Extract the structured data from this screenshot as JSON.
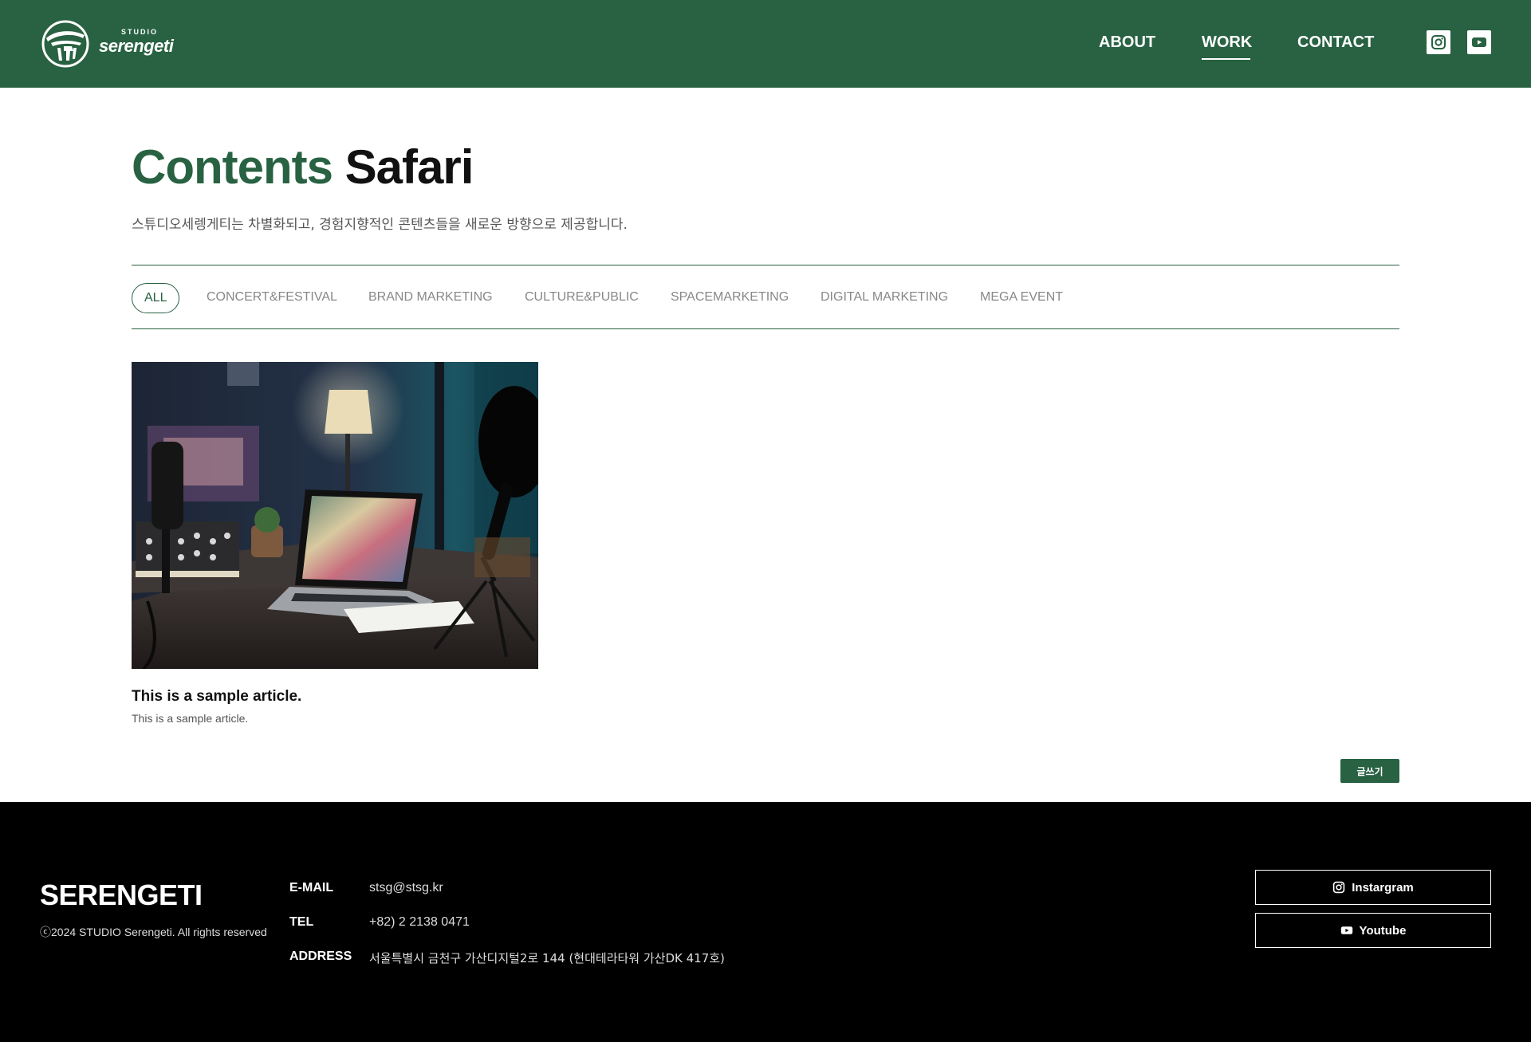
{
  "brand": {
    "logo_small": "STUDIO",
    "logo_name": "serengeti"
  },
  "nav": {
    "items": [
      {
        "label": "ABOUT"
      },
      {
        "label": "WORK"
      },
      {
        "label": "CONTACT"
      }
    ],
    "active": "WORK"
  },
  "social_icons": [
    "instagram-icon",
    "youtube-icon"
  ],
  "page": {
    "title_part1": "Contents",
    "title_part2": "Safari",
    "subtitle": "스튜디오세렝게티는 차별화되고, 경험지향적인 콘텐츠들을 새로운 방향으로 제공합니다."
  },
  "filters": {
    "items": [
      {
        "label": "ALL"
      },
      {
        "label": "CONCERT&FESTIVAL"
      },
      {
        "label": "BRAND MARKETING"
      },
      {
        "label": "CULTURE&PUBLIC"
      },
      {
        "label": "SPACEMARKETING"
      },
      {
        "label": "DIGITAL MARKETING"
      },
      {
        "label": "MEGA EVENT"
      }
    ],
    "active": "ALL"
  },
  "articles": [
    {
      "title": "This is a sample article.",
      "description": "This is a sample article."
    }
  ],
  "write_button": "글쓰기",
  "footer": {
    "brand": "SERENGETI",
    "copyright": "ⓒ2024 STUDIO Serengeti. All rights reserved",
    "contacts": [
      {
        "label": "E-MAIL",
        "value": "stsg@stsg.kr"
      },
      {
        "label": "TEL",
        "value": "+82) 2 2138 0471"
      },
      {
        "label": "ADDRESS",
        "value": "서울특별시 금천구 가산디지털2로 144 (현대테라타워 가산DK 417호)"
      }
    ],
    "buttons": [
      {
        "label": "Instargram",
        "icon": "instagram-icon"
      },
      {
        "label": "Youtube",
        "icon": "youtube-icon"
      }
    ]
  },
  "colors": {
    "brand_green": "#286242",
    "footer_bg": "#000000",
    "filter_text": "#888888"
  }
}
